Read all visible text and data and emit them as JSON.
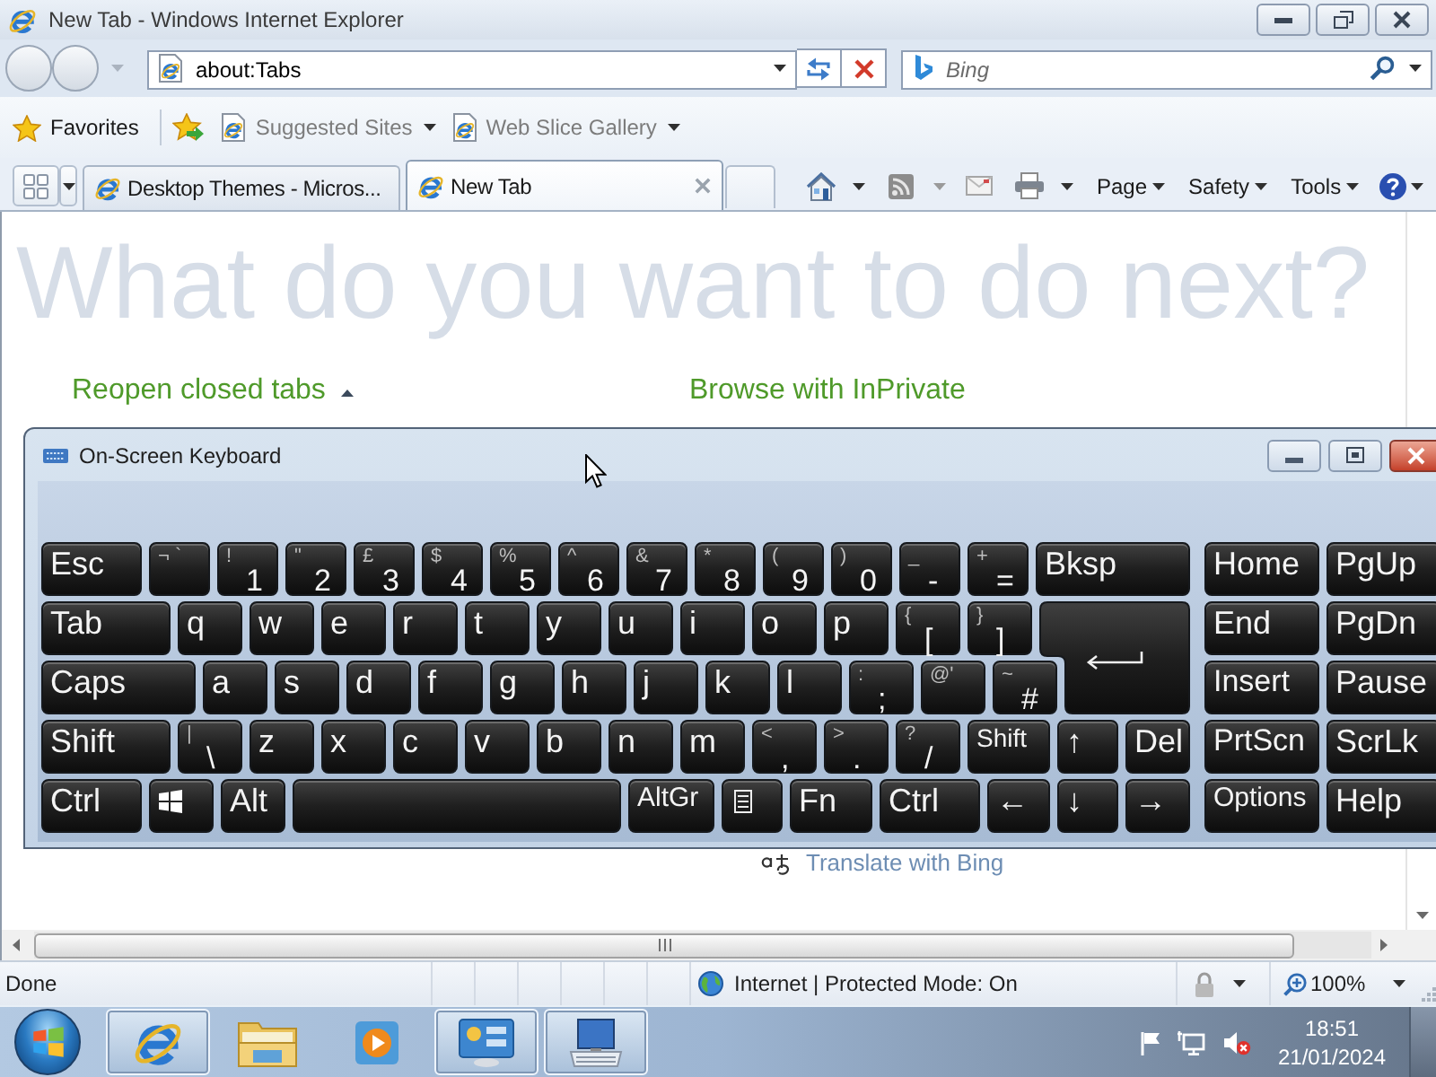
{
  "window": {
    "title": "New Tab - Windows Internet Explorer"
  },
  "address_bar": {
    "value": "about:Tabs"
  },
  "search": {
    "placeholder": "Bing"
  },
  "favorites_bar": {
    "label": "Favorites",
    "links": [
      {
        "label": "Suggested Sites"
      },
      {
        "label": "Web Slice Gallery"
      }
    ]
  },
  "tabs": [
    {
      "label": "Desktop Themes - Micros...",
      "selected": false
    },
    {
      "label": "New Tab",
      "selected": true
    }
  ],
  "command_bar": {
    "menus": [
      {
        "label": "Page"
      },
      {
        "label": "Safety"
      },
      {
        "label": "Tools"
      }
    ]
  },
  "page": {
    "heading": "What do you want to do next?",
    "links": [
      {
        "label": "Reopen closed tabs",
        "kind": "expander"
      },
      {
        "label": "Browse with InPrivate",
        "kind": "plain"
      }
    ],
    "translate": {
      "label": "Translate with Bing"
    }
  },
  "keyboard": {
    "title": "On-Screen Keyboard",
    "rows": [
      {
        "keys": [
          {
            "kind": "key",
            "label": "Esc"
          },
          {
            "kind": "key",
            "shift": "¬ `"
          },
          {
            "kind": "key",
            "shift": "!",
            "label": "1"
          },
          {
            "kind": "key",
            "shift": "\"",
            "label": "2"
          },
          {
            "kind": "key",
            "shift": "£",
            "label": "3"
          },
          {
            "kind": "key",
            "shift": "$",
            "label": "4"
          },
          {
            "kind": "key",
            "shift": "%",
            "label": "5"
          },
          {
            "kind": "key",
            "shift": "^",
            "label": "6"
          },
          {
            "kind": "key",
            "shift": "&",
            "label": "7"
          },
          {
            "kind": "key",
            "shift": "*",
            "label": "8"
          },
          {
            "kind": "key",
            "shift": "(",
            "label": "9"
          },
          {
            "kind": "key",
            "shift": ")",
            "label": "0"
          },
          {
            "kind": "key",
            "shift": "_",
            "label": "-"
          },
          {
            "kind": "key",
            "shift": "+",
            "label": "="
          },
          {
            "kind": "key",
            "label": "Bksp"
          }
        ]
      },
      {
        "keys": [
          {
            "kind": "key",
            "label": "Tab"
          },
          {
            "kind": "key",
            "label": "q"
          },
          {
            "kind": "key",
            "label": "w"
          },
          {
            "kind": "key",
            "label": "e"
          },
          {
            "kind": "key",
            "label": "r"
          },
          {
            "kind": "key",
            "label": "t"
          },
          {
            "kind": "key",
            "label": "y"
          },
          {
            "kind": "key",
            "label": "u"
          },
          {
            "kind": "key",
            "label": "i"
          },
          {
            "kind": "key",
            "label": "o"
          },
          {
            "kind": "key",
            "label": "p"
          },
          {
            "kind": "key",
            "shift": "{",
            "label": "["
          },
          {
            "kind": "key",
            "shift": "}",
            "label": "]"
          },
          {
            "kind": "enter"
          }
        ]
      },
      {
        "keys": [
          {
            "kind": "key",
            "label": "Caps"
          },
          {
            "kind": "key",
            "label": "a"
          },
          {
            "kind": "key",
            "label": "s"
          },
          {
            "kind": "key",
            "label": "d"
          },
          {
            "kind": "key",
            "label": "f"
          },
          {
            "kind": "key",
            "label": "g"
          },
          {
            "kind": "key",
            "label": "h"
          },
          {
            "kind": "key",
            "label": "j"
          },
          {
            "kind": "key",
            "label": "k"
          },
          {
            "kind": "key",
            "label": "l"
          },
          {
            "kind": "key",
            "shift": ":",
            "label": ";"
          },
          {
            "kind": "key",
            "shift": "@'"
          },
          {
            "kind": "key",
            "shift": "~",
            "label": "#"
          }
        ]
      },
      {
        "keys": [
          {
            "kind": "key",
            "label": "Shift"
          },
          {
            "kind": "key",
            "shift": "|",
            "label": "\\"
          },
          {
            "kind": "key",
            "label": "z"
          },
          {
            "kind": "key",
            "label": "x"
          },
          {
            "kind": "key",
            "label": "c"
          },
          {
            "kind": "key",
            "label": "v"
          },
          {
            "kind": "key",
            "label": "b"
          },
          {
            "kind": "key",
            "label": "n"
          },
          {
            "kind": "key",
            "label": "m"
          },
          {
            "kind": "key",
            "shift": "<",
            "label": ","
          },
          {
            "kind": "key",
            "shift": ">",
            "label": "."
          },
          {
            "kind": "key",
            "shift": "?",
            "label": "/"
          },
          {
            "kind": "key",
            "label": "Shift"
          },
          {
            "kind": "key",
            "label": "↑"
          },
          {
            "kind": "key",
            "label": "Del"
          }
        ]
      },
      {
        "keys": [
          {
            "kind": "key",
            "label": "Ctrl"
          },
          {
            "kind": "windows"
          },
          {
            "kind": "key",
            "label": "Alt"
          },
          {
            "kind": "space"
          },
          {
            "kind": "key",
            "label": "AltGr"
          },
          {
            "kind": "menu"
          },
          {
            "kind": "key",
            "label": "Fn"
          },
          {
            "kind": "key",
            "label": "Ctrl"
          },
          {
            "kind": "key",
            "label": "←"
          },
          {
            "kind": "key",
            "label": "↓"
          },
          {
            "kind": "key",
            "label": "→"
          }
        ]
      }
    ],
    "nav_rows": [
      {
        "keys": [
          {
            "kind": "key",
            "label": "Home"
          },
          {
            "kind": "key",
            "label": "PgUp"
          }
        ]
      },
      {
        "keys": [
          {
            "kind": "key",
            "label": "End"
          },
          {
            "kind": "key",
            "label": "PgDn"
          }
        ]
      },
      {
        "keys": [
          {
            "kind": "key",
            "label": "Insert"
          },
          {
            "kind": "key",
            "label": "Pause"
          }
        ]
      },
      {
        "keys": [
          {
            "kind": "key",
            "label": "PrtScn"
          },
          {
            "kind": "key",
            "label": "ScrLk"
          }
        ]
      },
      {
        "keys": [
          {
            "kind": "key",
            "label": "Options"
          },
          {
            "kind": "key",
            "label": "Help"
          }
        ]
      }
    ]
  },
  "status_bar": {
    "text": "Done",
    "zone": "Internet | Protected Mode: On",
    "zoom": "100%"
  },
  "taskbar": {
    "apps": [
      {
        "kind": "ie",
        "running": true
      },
      {
        "kind": "explorer",
        "running": false
      },
      {
        "kind": "media",
        "running": false
      },
      {
        "kind": "control_panel",
        "running": true
      },
      {
        "kind": "keyboard",
        "running": true
      }
    ],
    "time": "18:51",
    "date": "21/01/2024"
  }
}
